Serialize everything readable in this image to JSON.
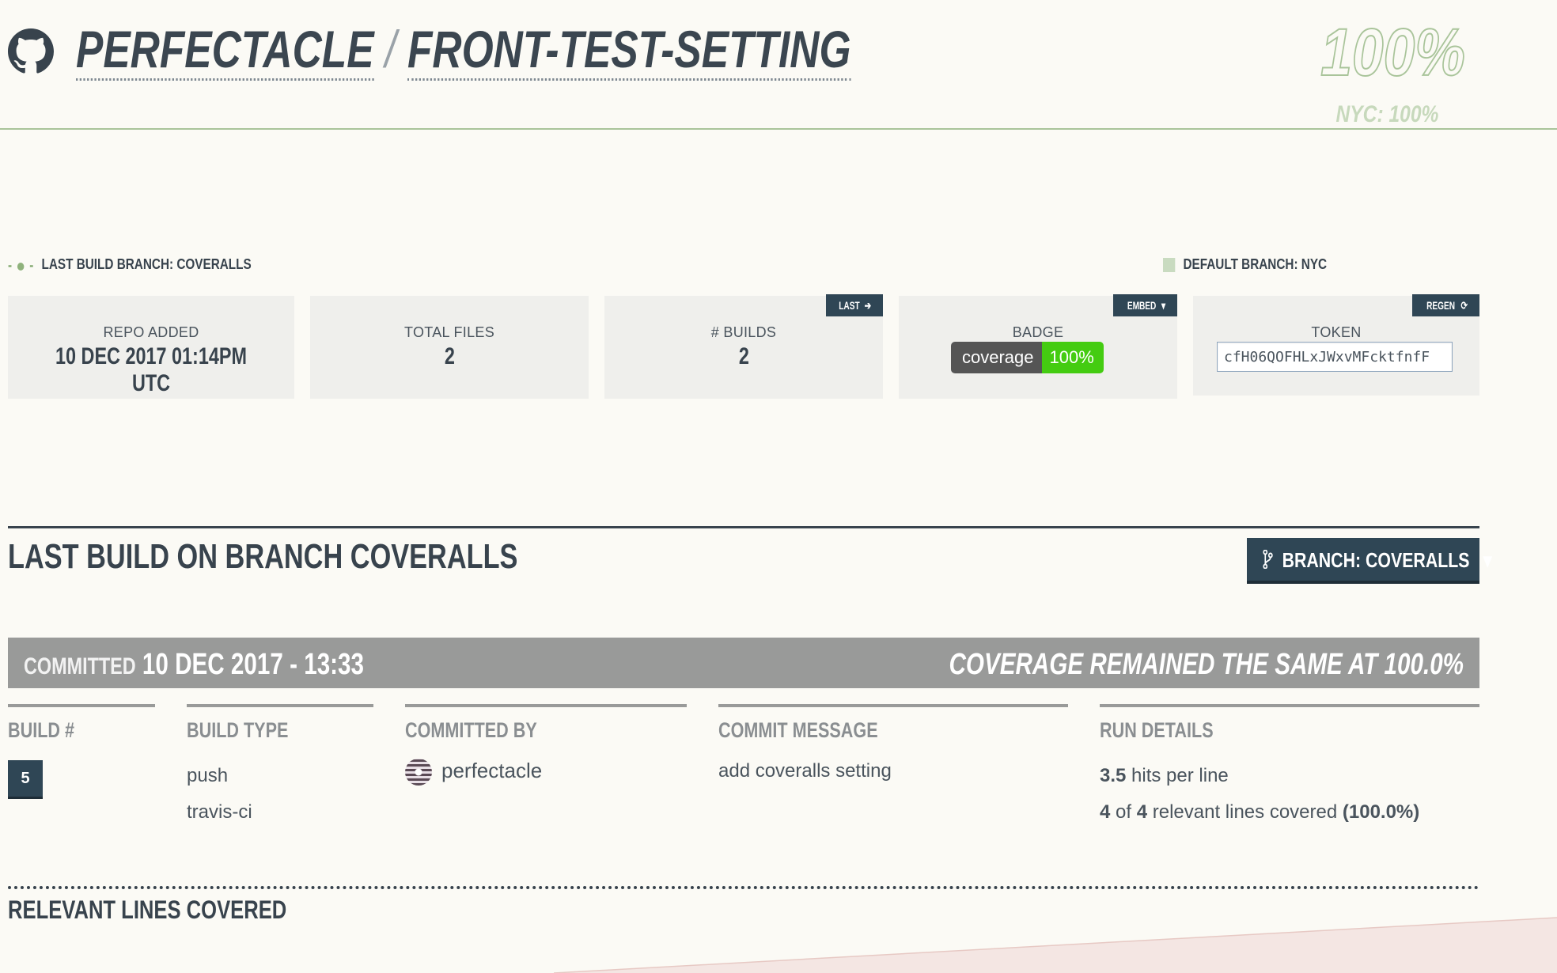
{
  "header": {
    "owner": "PERFECTACLE",
    "separator": "/",
    "repo": "FRONT-TEST-SETTING",
    "coverage_pct": "100%",
    "coverage_sub": "NYC: 100%"
  },
  "branches": {
    "last_build_branch": "LAST BUILD BRANCH: COVERALLS",
    "default_branch": "DEFAULT BRANCH: NYC"
  },
  "stats": {
    "repo_added": {
      "label": "REPO ADDED",
      "value": "10 DEC 2017 01:14PM UTC"
    },
    "total_files": {
      "label": "TOTAL FILES",
      "value": "2"
    },
    "builds": {
      "label": "# BUILDS",
      "value": "2",
      "button": "LAST"
    },
    "badge": {
      "label": "BADGE",
      "button": "EMBED",
      "left": "coverage",
      "right": "100%"
    },
    "token": {
      "label": "TOKEN",
      "button": "REGEN",
      "value": "cfH06QOFHLxJWxvMFcktfnfF"
    }
  },
  "section": {
    "title": "LAST BUILD ON BRANCH COVERALLS",
    "branch_button": "BRANCH: COVERALLS"
  },
  "commit_bar": {
    "committed_label": "COMMITTED",
    "date": "10 DEC 2017 - 13:33",
    "status": "COVERAGE REMAINED THE SAME AT 100.0%"
  },
  "columns": {
    "build": {
      "head": "BUILD #",
      "value": "5"
    },
    "build_type": {
      "head": "BUILD TYPE",
      "line1": "push",
      "line2": "travis-ci"
    },
    "committed_by": {
      "head": "COMMITTED BY",
      "user": "perfectacle"
    },
    "commit_message": {
      "head": "COMMIT MESSAGE",
      "text": "add coveralls setting"
    },
    "run_details": {
      "head": "RUN DETAILS",
      "hits": "3.5",
      "hits_suffix": " hits per line",
      "covered": "4",
      "of": " of ",
      "relevant": "4",
      "covered_suffix": " relevant lines covered ",
      "pct": "(100.0%)"
    }
  },
  "relevant_lines_title": "RELEVANT LINES COVERED",
  "colors": {
    "accent": "#2f4655",
    "coverage_green": "#a9c49a",
    "badge_green": "#44cc11"
  }
}
